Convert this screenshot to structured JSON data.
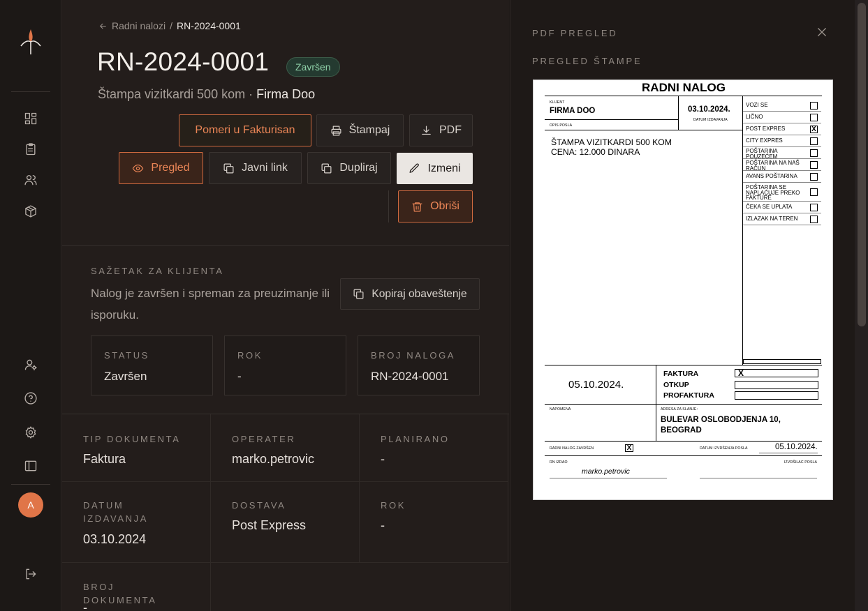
{
  "breadcrumb": {
    "parent": "Radni nalozi",
    "separator": "/",
    "current": "RN-2024-0001"
  },
  "order": {
    "title": "RN-2024-0001",
    "status": "Završen",
    "subtitle_desc": "Štampa vizitkardi 500 kom ·",
    "subtitle_client": "Firma Doo"
  },
  "actions": {
    "move": "Pomeri u Fakturisan",
    "print": "Štampaj",
    "pdf": "PDF",
    "preview": "Pregled",
    "public_link": "Javni link",
    "duplicate": "Dupliraj",
    "edit": "Izmeni",
    "delete": "Obriši"
  },
  "summary": {
    "label": "SAŽETAK ZA KLIJENTA",
    "text": "Nalog je završen i spreman za preuzimanje ili isporuku.",
    "copy_button": "Kopiraj obaveštenje",
    "cards": [
      {
        "label": "STATUS",
        "value": "Završen"
      },
      {
        "label": "ROK",
        "value": "-"
      },
      {
        "label": "BROJ NALOGA",
        "value": "RN-2024-0001"
      }
    ]
  },
  "details": [
    {
      "label": "TIP DOKUMENTA",
      "value": "Faktura"
    },
    {
      "label": "OPERATER",
      "value": "marko.petrovic"
    },
    {
      "label": "PLANIRANO",
      "value": "-"
    },
    {
      "label": "DATUM IZDAVANJA",
      "value": "03.10.2024"
    },
    {
      "label": "DOSTAVA",
      "value": "Post Express"
    },
    {
      "label": "ROK",
      "value": "-"
    },
    {
      "label": "BROJ DOKUMENTA",
      "value": "-"
    }
  ],
  "user": {
    "initial": "A"
  },
  "preview": {
    "title": "PDF PREGLED",
    "subtitle": "PREGLED ŠTAMPE",
    "doc": {
      "title": "RADNI NALOG",
      "client_label": "KLIJENT",
      "client": "FIRMA DOO",
      "date": "03.10.2024.",
      "date_label": "DATUM IZDAVANJA",
      "desc_label": "OPIS POSLA",
      "desc_line1": "ŠTAMPA VIZITKARDI 500 KOM",
      "desc_line2": "CENA: 12.000 DINARA",
      "options": [
        {
          "label": "VOZI SE",
          "checked": ""
        },
        {
          "label": "LIČNO",
          "checked": ""
        },
        {
          "label": "POST EXPRES",
          "checked": "X"
        },
        {
          "label": "CITY EXPRES",
          "checked": ""
        },
        {
          "label": "POŠTARINA POUZEĆEM",
          "checked": ""
        },
        {
          "label": "POŠTARINA NA NAŠ RAČUN",
          "checked": ""
        },
        {
          "label": "AVANS POŠTARINA",
          "checked": ""
        },
        {
          "label": "POŠTARINA SE NAPLAĆUJE PREKO FAKTURE",
          "checked": ""
        },
        {
          "label": "ČEKA SE UPLATA",
          "checked": ""
        },
        {
          "label": "IZLAZAK NA TEREN",
          "checked": ""
        }
      ],
      "due_date": "05.10.2024.",
      "doc_types": [
        {
          "label": "FAKTURA",
          "mark": "X"
        },
        {
          "label": "OTKUP",
          "mark": ""
        },
        {
          "label": "PROFAKTURA",
          "mark": ""
        }
      ],
      "note_label": "NAPOMENA",
      "address_label": "ADRESA ZA SLANJE:",
      "address_line1": "BULEVAR OSLOBODJENJA 10,",
      "address_line2": "BEOGRAD",
      "done_label": "RADNI NALOG ZAVRŠEN",
      "done_mark": "X",
      "exec_date_label": "DATUM IZVRŠENJA POSLA",
      "exec_date": "05.10.2024.",
      "issued_label": "RN IZDAO",
      "issued_by": "marko.petrovic",
      "executor_label": "IZVRŠILAC POSLA"
    }
  }
}
